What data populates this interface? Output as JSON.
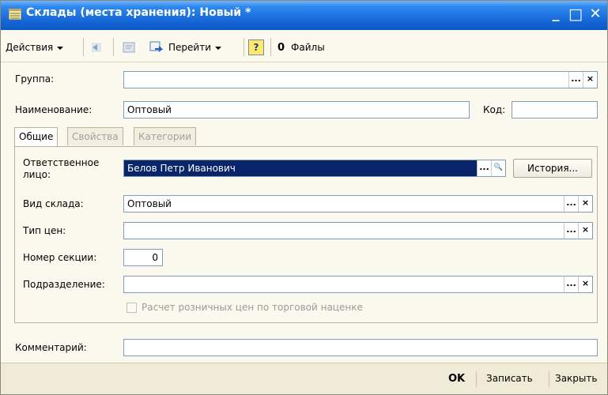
{
  "window": {
    "title": "Склады (места хранения): Новый *",
    "minimize_glyph": "_",
    "maximize_glyph": "□",
    "close_glyph": "✕"
  },
  "toolbar": {
    "actions_label": "Действия",
    "goto_label": "Перейти",
    "help_glyph": "?",
    "files_icon_glyph": "0",
    "files_label": "Файлы"
  },
  "form": {
    "group": {
      "label": "Группа:",
      "value": ""
    },
    "name": {
      "label": "Наименование:",
      "value": "Оптовый"
    },
    "code": {
      "label": "Код:",
      "value": ""
    },
    "tabs": [
      {
        "label": "Общие"
      },
      {
        "label": "Свойства"
      },
      {
        "label": "Категории"
      }
    ],
    "responsible": {
      "label_line1": "Ответственное",
      "label_line2": "лицо:",
      "value": "Белов Петр Иванович"
    },
    "history_button": "История...",
    "warehouse_type": {
      "label": "Вид склада:",
      "value": "Оптовый"
    },
    "price_type": {
      "label": "Тип цен:",
      "value": ""
    },
    "section_number": {
      "label": "Номер секции:",
      "value": "0"
    },
    "department": {
      "label": "Подразделение:",
      "value": ""
    },
    "retail_price_checkbox": {
      "label": "Расчет розничных цен по торговой наценке",
      "checked": false
    },
    "comment": {
      "label": "Комментарий:",
      "value": ""
    }
  },
  "buttons": {
    "select": "...",
    "clear": "×",
    "search": "🔍",
    "ok": "OK",
    "save": "Записать",
    "close": "Закрыть"
  },
  "colors": {
    "titlebar": "#1566D6",
    "background": "#FBF9EE",
    "selection": "#0A246A"
  }
}
